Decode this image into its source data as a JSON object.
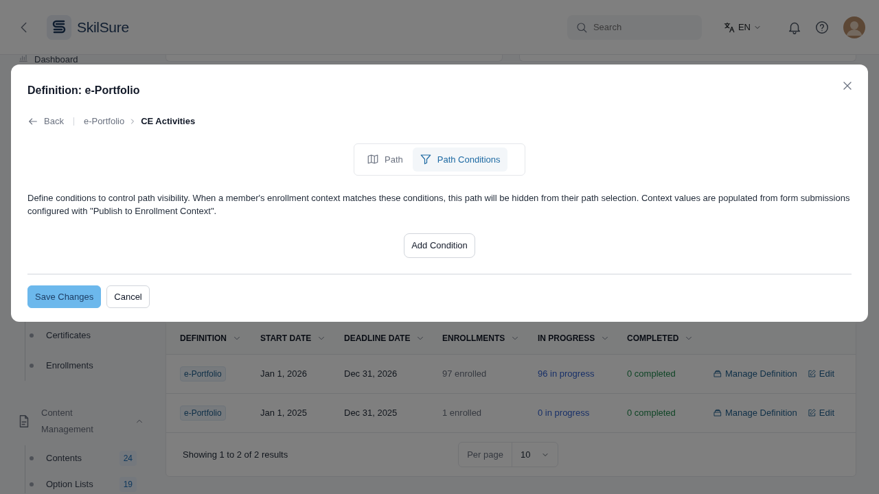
{
  "header": {
    "brand": "SkilSure",
    "search": {
      "placeholder": "Search"
    },
    "language": "EN"
  },
  "sidebar": {
    "items": [
      {
        "kind": "link",
        "label": "Dashboard"
      },
      {
        "kind": "subitem",
        "label": "Certificates"
      },
      {
        "kind": "subitem",
        "label": "Enrollments"
      },
      {
        "kind": "group",
        "label": "Content Management",
        "expanded": true,
        "children": [
          {
            "label": "Contents",
            "count": "24"
          },
          {
            "label": "Option Lists",
            "count": "19"
          }
        ]
      }
    ]
  },
  "table": {
    "columns": [
      "DEFINITION",
      "START DATE",
      "DEADLINE DATE",
      "ENROLLMENTS",
      "IN PROGRESS",
      "COMPLETED"
    ],
    "rows": [
      {
        "definition": "e-Portfolio",
        "start_date": "Jan 1, 2026",
        "deadline_date": "Dec 31, 2026",
        "enrollments": "97 enrolled",
        "in_progress": "96 in progress",
        "completed": "0 completed",
        "actions": [
          "Manage Definition",
          "Edit"
        ]
      },
      {
        "definition": "e-Portfolio",
        "start_date": "Jan 1, 2025",
        "deadline_date": "Dec 31, 2025",
        "enrollments": "1 enrolled",
        "in_progress": "0 in progress",
        "completed": "0 completed",
        "actions": [
          "Manage Definition",
          "Edit"
        ]
      }
    ],
    "summary": "Showing 1 to 2 of 2 results",
    "per_page_label": "Per page",
    "per_page": "10"
  },
  "modal": {
    "title": "Definition: e-Portfolio",
    "back": "Back",
    "breadcrumb": [
      "e-Portfolio",
      "CE Activities"
    ],
    "tabs": [
      {
        "label": "Path",
        "selected": false
      },
      {
        "label": "Path Conditions",
        "selected": true
      }
    ],
    "description": "Define conditions to control path visibility. When a member's enrollment context matches these conditions, this path will be hidden from their path selection. Context values are populated from form submissions configured with \"Publish to Enrollment Context\".",
    "add_button": "Add Condition",
    "buttons": [
      {
        "label": "Save Changes",
        "kind": "primary"
      },
      {
        "label": "Cancel",
        "kind": "secondary"
      }
    ]
  }
}
